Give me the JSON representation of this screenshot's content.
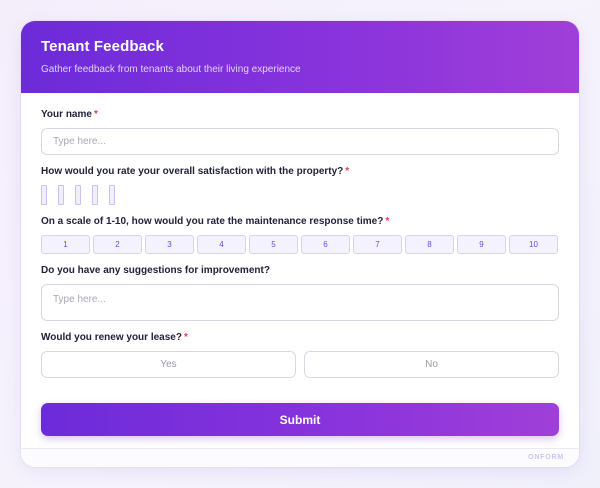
{
  "form": {
    "title": "Tenant Feedback",
    "subtitle": "Gather feedback from tenants about their living experience",
    "required_marker": "*",
    "fields": {
      "name": {
        "label": "Your name",
        "placeholder": "Type here...",
        "required": true
      },
      "satisfaction": {
        "label": "How would you rate your overall satisfaction with the property?",
        "required": true,
        "star_count": 5
      },
      "maintenance": {
        "label": "On a scale of 1-10, how would you rate the maintenance response time?",
        "required": true,
        "options": [
          "1",
          "2",
          "3",
          "4",
          "5",
          "6",
          "7",
          "8",
          "9",
          "10"
        ]
      },
      "suggestions": {
        "label": "Do you have any suggestions for improvement?",
        "placeholder": "Type here...",
        "required": false
      },
      "renew": {
        "label": "Would you renew your lease?",
        "required": true,
        "yes_label": "Yes",
        "no_label": "No"
      }
    },
    "submit_label": "Submit",
    "brand": "ONFORM"
  },
  "colors": {
    "accent_start": "#6c2bd9",
    "accent_end": "#a03fd8",
    "required": "#e2404f",
    "scale_text": "#6d4ad6"
  }
}
